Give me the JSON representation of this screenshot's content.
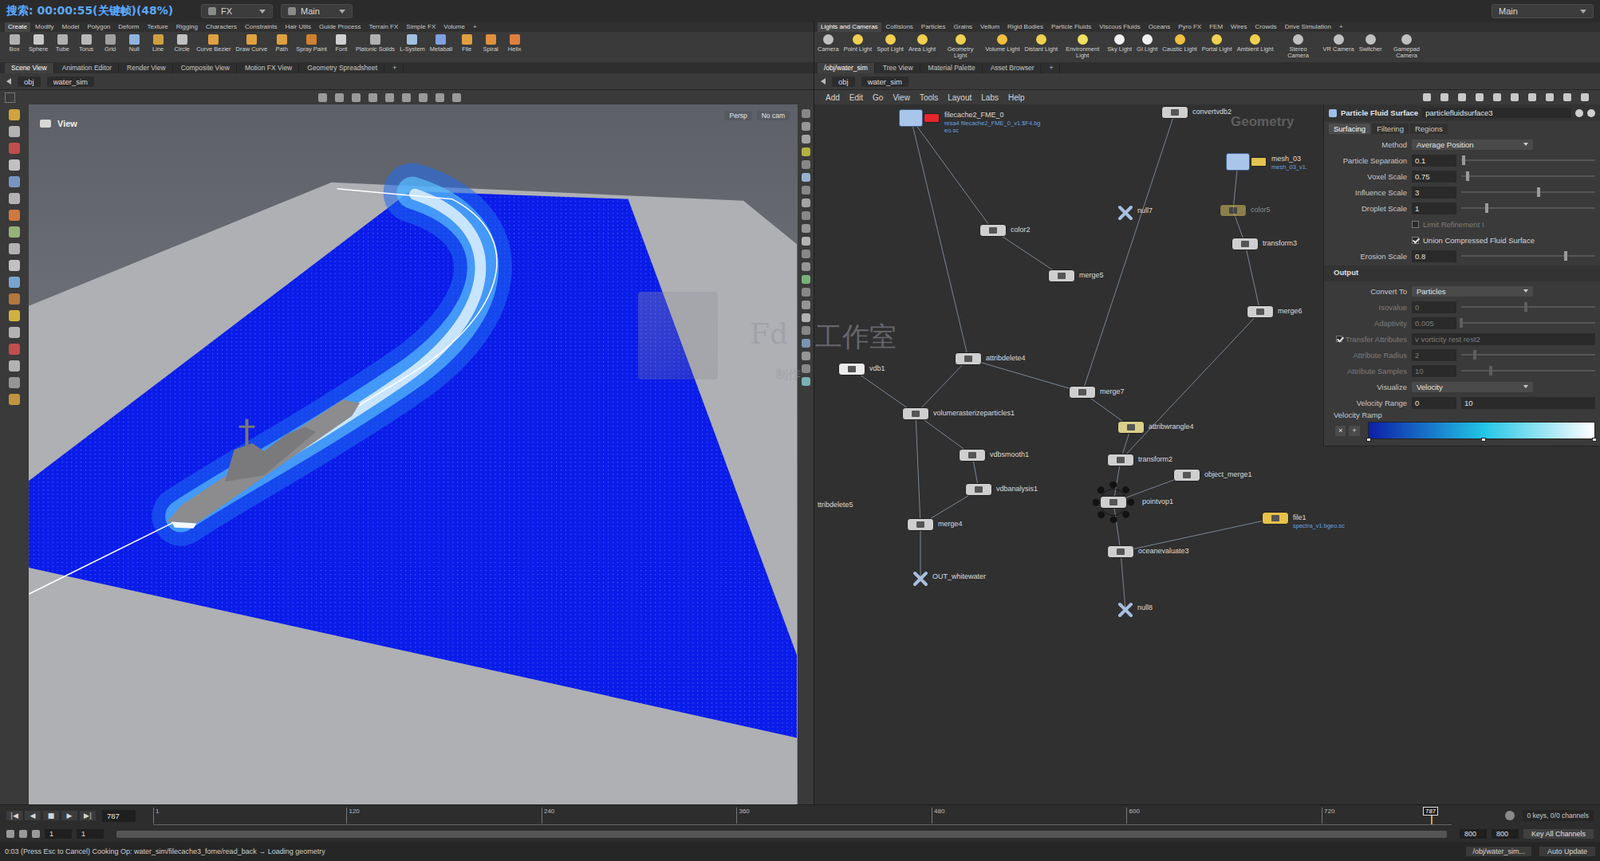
{
  "recorder_overlay": "搜索: 00:00:55(关键帧)(48%)",
  "desks": [
    {
      "label": "FX"
    },
    {
      "label": "Main"
    }
  ],
  "desk_right": "Main",
  "shelf_left": {
    "tabs": [
      {
        "label": "Create",
        "selected": true
      },
      {
        "label": "Modify",
        "selected": false
      },
      {
        "label": "Model",
        "selected": false
      },
      {
        "label": "Polygon",
        "selected": false
      },
      {
        "label": "Deform",
        "selected": false
      },
      {
        "label": "Texture",
        "selected": false
      },
      {
        "label": "Rigging",
        "selected": false
      },
      {
        "label": "Characters",
        "selected": false
      },
      {
        "label": "Constraints",
        "selected": false
      },
      {
        "label": "Hair Utils",
        "selected": false
      },
      {
        "label": "Guide Process",
        "selected": false
      },
      {
        "label": "Terrain FX",
        "selected": false
      },
      {
        "label": "Simple FX",
        "selected": false
      },
      {
        "label": "Volume",
        "selected": false
      },
      {
        "label": "+",
        "selected": false
      }
    ],
    "tools": [
      {
        "label": "Box",
        "color": "#b0b0b0"
      },
      {
        "label": "Sphere",
        "color": "#c8c8c8"
      },
      {
        "label": "Tube",
        "color": "#b0b0b0"
      },
      {
        "label": "Torus",
        "color": "#b8b8b8"
      },
      {
        "label": "Grid",
        "color": "#a0a0a0"
      },
      {
        "label": "Null",
        "color": "#8fb3e0"
      },
      {
        "label": "Line",
        "color": "#d0a040"
      },
      {
        "label": "Circle",
        "color": "#c0c0c0"
      },
      {
        "label": "Curve Bezier",
        "color": "#e0a040"
      },
      {
        "label": "Draw Curve",
        "color": "#e0a040"
      },
      {
        "label": "Path",
        "color": "#e0a040"
      },
      {
        "label": "Spray Paint",
        "color": "#d08030"
      },
      {
        "label": "Font",
        "color": "#d0d0d0"
      },
      {
        "label": "Platonic Solids",
        "color": "#b0b0b0"
      },
      {
        "label": "L-System",
        "color": "#a0c0e0"
      },
      {
        "label": "Metaball",
        "color": "#7fa0e0"
      },
      {
        "label": "File",
        "color": "#e0a040"
      },
      {
        "label": "Spiral",
        "color": "#e09040"
      },
      {
        "label": "Helix",
        "color": "#e08040"
      }
    ]
  },
  "shelf_right": {
    "tabs": [
      {
        "label": "Lights and Cameras",
        "selected": true
      },
      {
        "label": "Collisions",
        "selected": false
      },
      {
        "label": "Particles",
        "selected": false
      },
      {
        "label": "Grains",
        "selected": false
      },
      {
        "label": "Vellum",
        "selected": false
      },
      {
        "label": "Rigid Bodies",
        "selected": false
      },
      {
        "label": "Particle Fluids",
        "selected": false
      },
      {
        "label": "Viscous Fluids",
        "selected": false
      },
      {
        "label": "Oceans",
        "selected": false
      },
      {
        "label": "Pyro FX",
        "selected": false
      },
      {
        "label": "FEM",
        "selected": false
      },
      {
        "label": "Wires",
        "selected": false
      },
      {
        "label": "Crowds",
        "selected": false
      },
      {
        "label": "Drive Simulation",
        "selected": false
      },
      {
        "label": "+",
        "selected": false
      }
    ],
    "tools": [
      {
        "label": "Camera",
        "color": "#c0c0c0"
      },
      {
        "label": "Point Light",
        "color": "#f0d050"
      },
      {
        "label": "Spot Light",
        "color": "#f0d050"
      },
      {
        "label": "Area Light",
        "color": "#f0d050"
      },
      {
        "label": "Geometry Light",
        "color": "#f0d050"
      },
      {
        "label": "Volume Light",
        "color": "#f0c040"
      },
      {
        "label": "Distant Light",
        "color": "#f0d050"
      },
      {
        "label": "Environment Light",
        "color": "#f0e060"
      },
      {
        "label": "Sky Light",
        "color": "#f0f0f0"
      },
      {
        "label": "GI Light",
        "color": "#f0f0f0"
      },
      {
        "label": "Caustic Light",
        "color": "#f0c040"
      },
      {
        "label": "Portal Light",
        "color": "#f0d050"
      },
      {
        "label": "Ambient Light",
        "color": "#f0d050"
      },
      {
        "label": "Stereo Camera",
        "color": "#c0c0c0"
      },
      {
        "label": "VR Camera",
        "color": "#c0c0c0"
      },
      {
        "label": "Switcher",
        "color": "#c0c0c0"
      },
      {
        "label": "Gamepad Camera",
        "color": "#c0c0c0"
      }
    ]
  },
  "pane_tabs_left": [
    {
      "label": "Scene View",
      "selected": true
    },
    {
      "label": "Animation Editor",
      "selected": false
    },
    {
      "label": "Render View",
      "selected": false
    },
    {
      "label": "Composite View",
      "selected": false
    },
    {
      "label": "Motion FX View",
      "selected": false
    },
    {
      "label": "Geometry Spreadsheet",
      "selected": false
    },
    {
      "label": "+",
      "selected": false
    }
  ],
  "pane_tabs_right": [
    {
      "label": "/obj/water_sim",
      "selected": true
    },
    {
      "label": "Tree View",
      "selected": false
    },
    {
      "label": "Material Palette",
      "selected": false
    },
    {
      "label": "Asset Browser",
      "selected": false
    },
    {
      "label": "+",
      "selected": false
    }
  ],
  "path_left": [
    "obj",
    "water_sim"
  ],
  "path_right": [
    "obj",
    "water_sim"
  ],
  "viewport": {
    "title": "View",
    "camera": "Persp",
    "cam_menu": "No cam"
  },
  "watermark": {
    "brand": "Fd",
    "studio": "工作室",
    "caption": "制作"
  },
  "network": {
    "menu": [
      "Add",
      "Edit",
      "Go",
      "View",
      "Tools",
      "Layout",
      "Labs",
      "Help"
    ],
    "context_label": "Geometry",
    "nodes": [
      {
        "name": "filecache2_FME_0",
        "kind": "cache",
        "color": "#e3262b",
        "bypassed": false,
        "ring": false,
        "sublabels": [
          "resa4 filecache2_FME_0_v1.$F4.bg",
          "eo.sc"
        ]
      },
      {
        "name": "convertvdb2",
        "kind": "box",
        "color": "#cfcfcf",
        "bypassed": false,
        "ring": false,
        "sublabels": []
      },
      {
        "name": "mesh_03",
        "kind": "cache",
        "color": "#e2c250",
        "bypassed": false,
        "ring": false,
        "sublabels": [
          "mesh_03_v1."
        ]
      },
      {
        "name": "null7",
        "kind": "null",
        "color": "#a8c0e0",
        "bypassed": false,
        "ring": false,
        "sublabels": []
      },
      {
        "name": "color5",
        "kind": "box",
        "color": "#d8c060",
        "bypassed": true,
        "ring": false,
        "sublabels": []
      },
      {
        "name": "color2",
        "kind": "box",
        "color": "#cfcfcf",
        "bypassed": false,
        "ring": false,
        "sublabels": []
      },
      {
        "name": "transform3",
        "kind": "box",
        "color": "#cfcfcf",
        "bypassed": false,
        "ring": false,
        "sublabels": []
      },
      {
        "name": "merge5",
        "kind": "box",
        "color": "#cfcfcf",
        "bypassed": false,
        "ring": false,
        "sublabels": []
      },
      {
        "name": "merge6",
        "kind": "box",
        "color": "#cfcfcf",
        "bypassed": false,
        "ring": false,
        "sublabels": []
      },
      {
        "name": "vdb1",
        "kind": "box",
        "color": "#ececec",
        "bypassed": false,
        "ring": false,
        "sublabels": []
      },
      {
        "name": "attribdelete4",
        "kind": "box",
        "color": "#cfcfcf",
        "bypassed": false,
        "ring": false,
        "sublabels": []
      },
      {
        "name": "merge7",
        "kind": "box",
        "color": "#cfcfcf",
        "bypassed": false,
        "ring": false,
        "sublabels": []
      },
      {
        "name": "volumerasterizeparticles1",
        "kind": "box",
        "color": "#cfcfcf",
        "bypassed": false,
        "ring": false,
        "sublabels": []
      },
      {
        "name": "attribwrangle4",
        "kind": "box",
        "color": "#d8cf8a",
        "bypassed": false,
        "ring": false,
        "sublabels": []
      },
      {
        "name": "vdbsmooth1",
        "kind": "box",
        "color": "#cfcfcf",
        "bypassed": false,
        "ring": false,
        "sublabels": []
      },
      {
        "name": "transform2",
        "kind": "box",
        "color": "#cfcfcf",
        "bypassed": false,
        "ring": false,
        "sublabels": []
      },
      {
        "name": "object_merge1",
        "kind": "box",
        "color": "#cfcfcf",
        "bypassed": false,
        "ring": false,
        "sublabels": []
      },
      {
        "name": "vdbanalysis1",
        "kind": "box",
        "color": "#cfcfcf",
        "bypassed": false,
        "ring": false,
        "sublabels": []
      },
      {
        "name": "pointvop1",
        "kind": "box",
        "color": "#cfcfcf",
        "bypassed": false,
        "ring": true,
        "sublabels": []
      },
      {
        "name": "ttribdelete5",
        "kind": "cut",
        "color": "#cfcfcf",
        "bypassed": false,
        "ring": false,
        "sublabels": []
      },
      {
        "name": "file1",
        "kind": "box",
        "color": "#e6c24a",
        "bypassed": false,
        "ring": false,
        "sublabels": [
          "spectra_v1.bgeo.sc"
        ]
      },
      {
        "name": "merge4",
        "kind": "box",
        "color": "#cfcfcf",
        "bypassed": false,
        "ring": false,
        "sublabels": []
      },
      {
        "name": "oceanevaluate3",
        "kind": "box",
        "color": "#cfcfcf",
        "bypassed": false,
        "ring": false,
        "sublabels": []
      },
      {
        "name": "OUT_whitewater",
        "kind": "null",
        "color": "#a8c0e0",
        "bypassed": false,
        "ring": false,
        "sublabels": []
      },
      {
        "name": "null8",
        "kind": "null",
        "color": "#a8c0e0",
        "bypassed": false,
        "ring": false,
        "sublabels": []
      }
    ],
    "wires": [
      {
        "from": "filecache2_FME_0",
        "to": "color2"
      },
      {
        "from": "filecache2_FME_0",
        "to": "attribdelete4"
      },
      {
        "from": "color2",
        "to": "merge5"
      },
      {
        "from": "convertvdb2",
        "to": "merge7"
      },
      {
        "from": "mesh_03",
        "to": "color5"
      },
      {
        "from": "color5",
        "to": "transform3"
      },
      {
        "from": "transform3",
        "to": "merge6"
      },
      {
        "from": "merge6",
        "to": "transform2"
      },
      {
        "from": "attribdelete4",
        "to": "volumerasterizeparticles1"
      },
      {
        "from": "attribdelete4",
        "to": "merge7"
      },
      {
        "from": "merge7",
        "to": "attribwrangle4"
      },
      {
        "from": "attribwrangle4",
        "to": "transform2"
      },
      {
        "from": "transform2",
        "to": "pointvop1"
      },
      {
        "from": "object_merge1",
        "to": "pointvop1"
      },
      {
        "from": "pointvop1",
        "to": "oceanevaluate3"
      },
      {
        "from": "file1",
        "to": "oceanevaluate3"
      },
      {
        "from": "oceanevaluate3",
        "to": "null8"
      },
      {
        "from": "vdb1",
        "to": "volumerasterizeparticles1"
      },
      {
        "from": "volumerasterizeparticles1",
        "to": "vdbsmooth1"
      },
      {
        "from": "vdbsmooth1",
        "to": "vdbanalysis1"
      },
      {
        "from": "vdbanalysis1",
        "to": "merge4"
      },
      {
        "from": "volumerasterizeparticles1",
        "to": "merge4"
      },
      {
        "from": "merge4",
        "to": "OUT_whitewater"
      }
    ]
  },
  "parameters": {
    "type": "Particle Fluid Surface",
    "name": "particlefluidsurface3",
    "tabs": [
      {
        "label": "Surfacing",
        "selected": true
      },
      {
        "label": "Filtering",
        "selected": false
      },
      {
        "label": "Regions",
        "selected": false
      }
    ],
    "rows": [
      {
        "kind": "menu",
        "label": "Method",
        "value": "Average Position",
        "disabled": false
      },
      {
        "kind": "slider",
        "label": "Particle Separation",
        "value": "0.1",
        "level": 0.02,
        "disabled": false
      },
      {
        "kind": "slider",
        "label": "Voxel Scale",
        "value": "0.75",
        "level": 0.05,
        "disabled": false
      },
      {
        "kind": "slider",
        "label": "Influence Scale",
        "value": "3",
        "level": 0.58,
        "disabled": false
      },
      {
        "kind": "slider",
        "label": "Droplet Scale",
        "value": "1",
        "level": 0.19,
        "disabled": false
      },
      {
        "kind": "checkbox",
        "label": "Limit Refinement I",
        "checked": false,
        "disabled": true
      },
      {
        "kind": "checkbox",
        "label": "Union Compressed Fluid Surface",
        "checked": true,
        "disabled": false
      },
      {
        "kind": "slider",
        "label": "Erosion Scale",
        "value": "0.8",
        "level": 0.78,
        "disabled": false
      },
      {
        "kind": "section",
        "label": "Output",
        "disabled": false
      },
      {
        "kind": "menu",
        "label": "Convert To",
        "value": "Particles",
        "disabled": false
      },
      {
        "kind": "slider",
        "label": "Isovalue",
        "value": "0",
        "level": 0.48,
        "disabled": true
      },
      {
        "kind": "slider",
        "label": "Adaptivity",
        "value": "0.005",
        "level": 0.0,
        "disabled": true
      },
      {
        "kind": "text",
        "label": "Transfer Attributes",
        "value": "v vorticity rest rest2",
        "checked": true,
        "disabled": true
      },
      {
        "kind": "slider",
        "label": "Attribute Radius",
        "value": "2",
        "level": 0.1,
        "disabled": true
      },
      {
        "kind": "slider",
        "label": "Attribute Samples",
        "value": "10",
        "level": 0.22,
        "disabled": true
      },
      {
        "kind": "menu",
        "label": "Visualize",
        "value": "Velocity",
        "disabled": false
      },
      {
        "kind": "range",
        "label": "Velocity Range",
        "value": "0",
        "value2": "10",
        "disabled": false
      },
      {
        "kind": "ramp",
        "label": "Velocity Ramp",
        "buttons": [
          "×",
          "+"
        ],
        "stops": [
          {
            "position": 0,
            "color": "#0c1ea8"
          },
          {
            "position": 0.51,
            "color": "#22c6e6"
          },
          {
            "position": 1,
            "color": "#ffffff"
          }
        ],
        "disabled": false
      }
    ]
  },
  "timeline": {
    "controls": [
      "|◀",
      "◀",
      "■",
      "▶",
      "▶|"
    ],
    "frame": "787",
    "ticks": [
      "1",
      "120",
      "240",
      "360",
      "480",
      "600",
      "720"
    ],
    "playhead": {
      "label": "787",
      "level": 0.984
    },
    "keys_info": "0 keys, 0/0 channels"
  },
  "range": {
    "start": "1",
    "start2": "1",
    "end": "800",
    "end2": "800",
    "key_button": "Key All Channels"
  },
  "status_bar": {
    "message": "0:03 (Press Esc to Cancel) Cooking Op: water_sim/filecache3_fome/read_back → Loading geometry",
    "path": "/obj/water_sim...",
    "update": "Auto Update"
  }
}
